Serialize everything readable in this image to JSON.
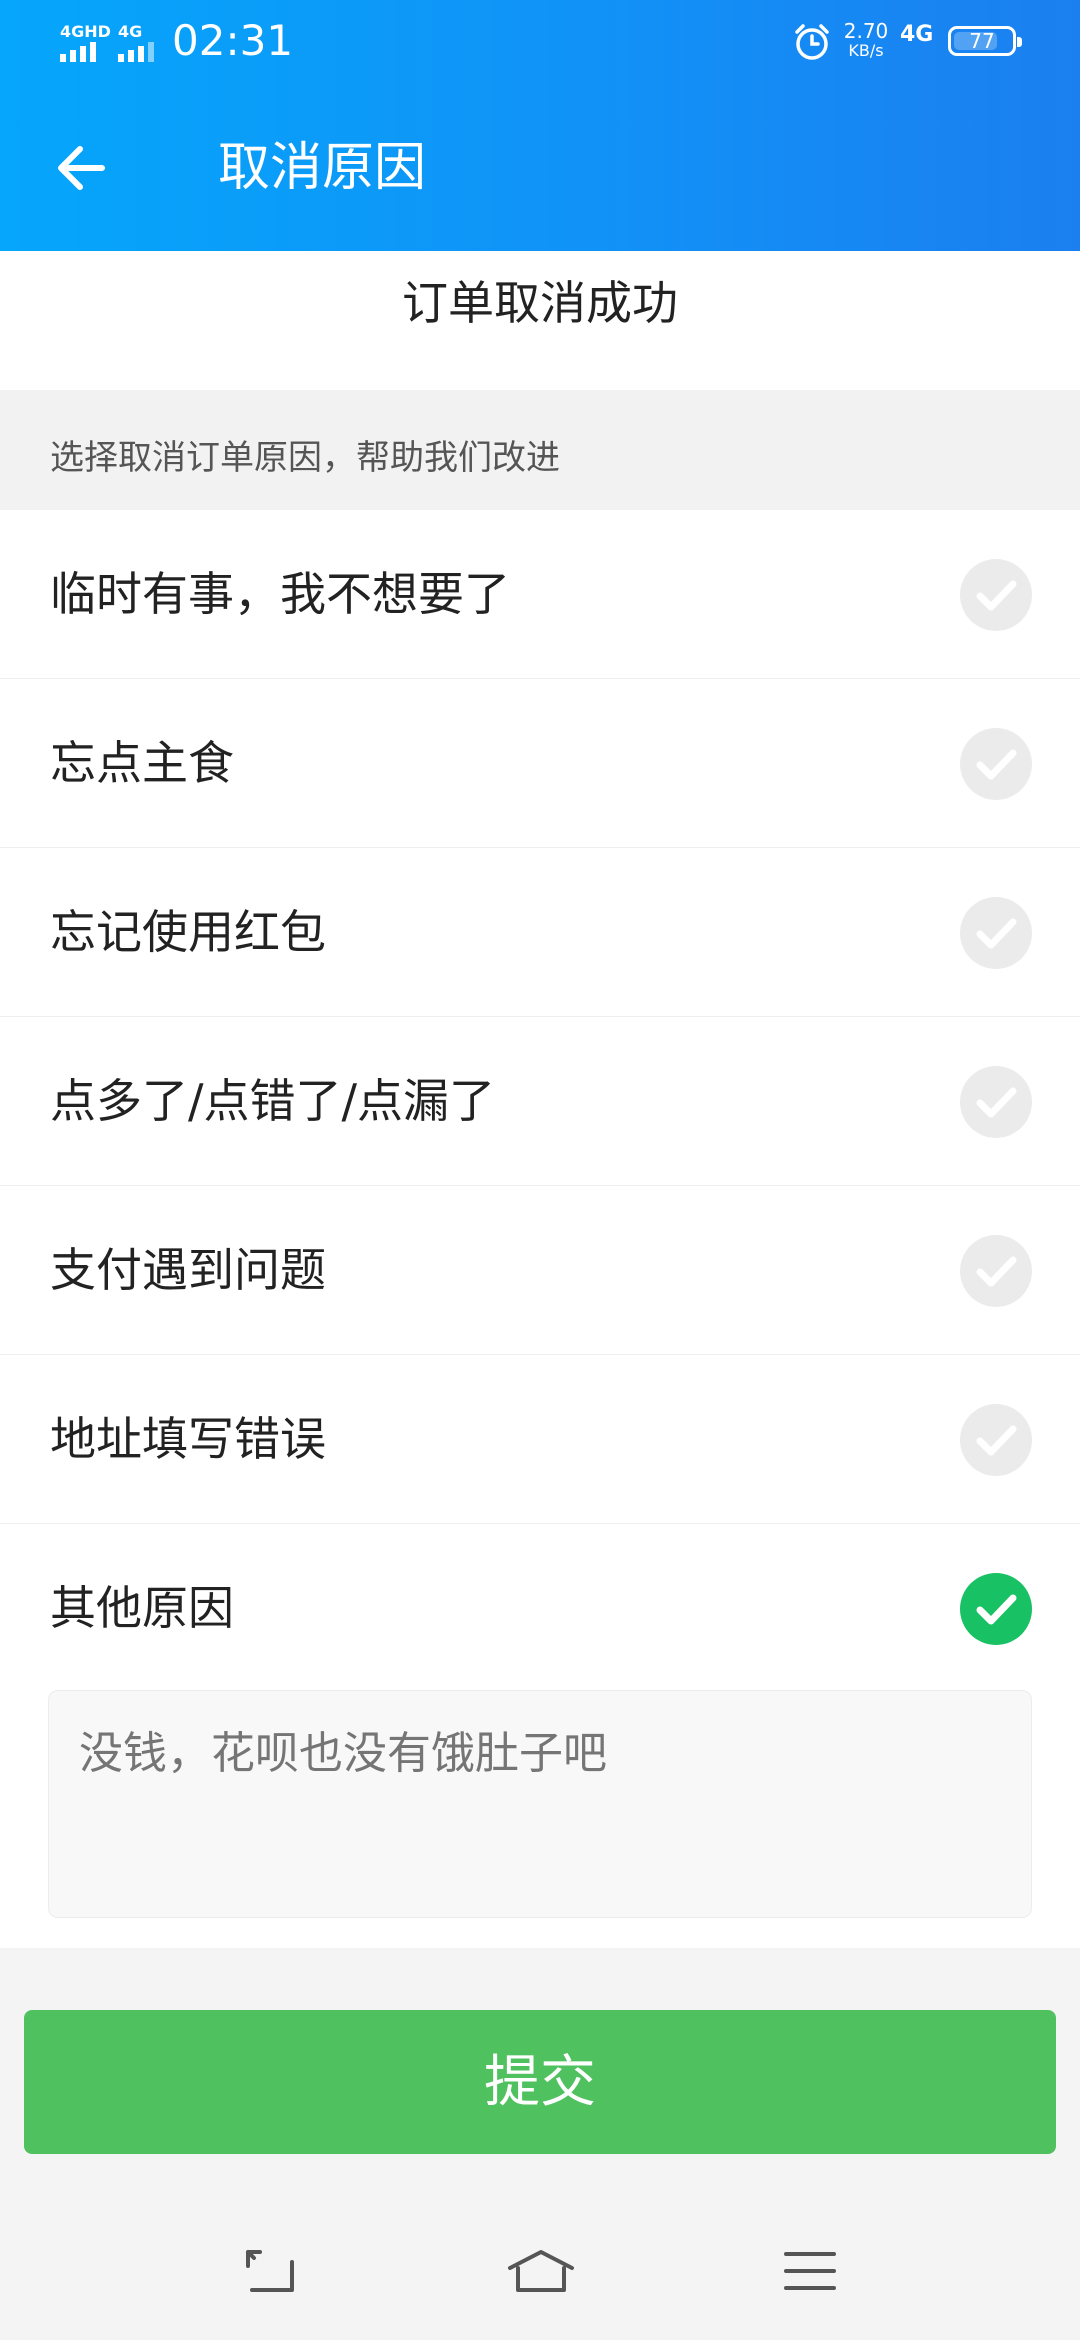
{
  "status_bar": {
    "signal1_tag": "4GHD",
    "signal2_tag": "4G",
    "time": "02:31",
    "speed_value": "2.70",
    "speed_unit": "KB/s",
    "network": "4G",
    "battery": "77",
    "battery_level": 0.77
  },
  "header": {
    "title": "取消原因",
    "back_icon": "arrow-left-icon"
  },
  "success_text": "订单取消成功",
  "hint_text": "选择取消订单原因，帮助我们改进",
  "reasons": [
    {
      "label": "临时有事，我不想要了",
      "selected": false
    },
    {
      "label": "忘点主食",
      "selected": false
    },
    {
      "label": "忘记使用红包",
      "selected": false
    },
    {
      "label": "点多了/点错了/点漏了",
      "selected": false
    },
    {
      "label": "支付遇到问题",
      "selected": false
    },
    {
      "label": "地址填写错误",
      "selected": false
    },
    {
      "label": "其他原因",
      "selected": true
    }
  ],
  "other_reason_text": "没钱，花呗也没有饿肚子吧",
  "submit_label": "提交",
  "colors": {
    "header_start": "#05a6fb",
    "header_end": "#1b7ff0",
    "check_selected": "#18c163",
    "check_unselected": "#ebebeb",
    "submit_bg": "#4fc15f"
  },
  "nav_icons": [
    "back-nav-icon",
    "home-nav-icon",
    "menu-nav-icon"
  ]
}
